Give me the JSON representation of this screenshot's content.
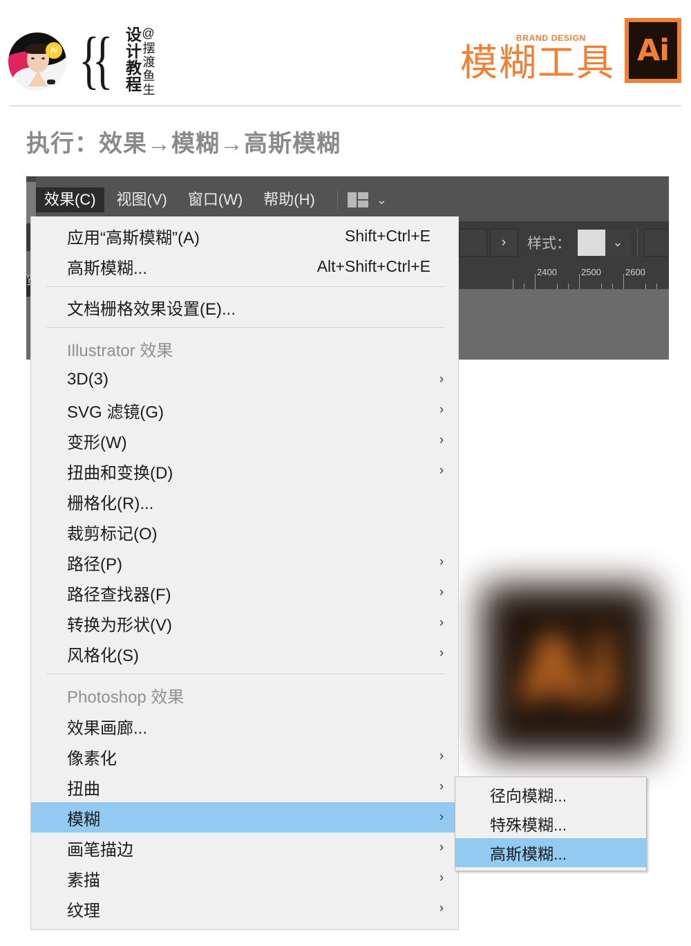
{
  "header": {
    "avatar_badge": "hi",
    "braces": "{{",
    "vertical_main": "设计教程",
    "vertical_sub": "@摆渡鱼生",
    "brand_sub": "BRAND DESIGN",
    "brand_title": "模糊工具",
    "ai_badge": "Ai"
  },
  "subtitle": "执行：效果→模糊→高斯模糊",
  "app": {
    "menubar": [
      {
        "label": "效果(C)",
        "active": true
      },
      {
        "label": "视图(V)",
        "active": false
      },
      {
        "label": "窗口(W)",
        "active": false
      },
      {
        "label": "帮助(H)",
        "active": false
      }
    ],
    "workspace_icon": "layout-grid-icon",
    "workspace_chevron": "⌄",
    "control_bar": {
      "arrow_button": "›",
      "style_label": "样式：",
      "style_chevron": "⌄"
    },
    "ruler_labels": [
      "2400",
      "2500",
      "2600"
    ],
    "left_panel_tab": "览"
  },
  "menu": {
    "items": [
      {
        "label": "应用“高斯模糊”(A)",
        "accel": "Shift+Ctrl+E",
        "arrow": "",
        "kind": "item",
        "selected": false
      },
      {
        "label": "高斯模糊...",
        "accel": "Alt+Shift+Ctrl+E",
        "arrow": "",
        "kind": "item",
        "selected": false
      },
      {
        "kind": "divider"
      },
      {
        "label": "文档栅格效果设置(E)...",
        "accel": "",
        "arrow": "",
        "kind": "item",
        "selected": false
      },
      {
        "kind": "divider"
      },
      {
        "label": "Illustrator 效果",
        "accel": "",
        "arrow": "",
        "kind": "header",
        "selected": false
      },
      {
        "label": "3D(3)",
        "accel": "",
        "arrow": "›",
        "kind": "item",
        "selected": false
      },
      {
        "label": "SVG 滤镜(G)",
        "accel": "",
        "arrow": "›",
        "kind": "item",
        "selected": false
      },
      {
        "label": "变形(W)",
        "accel": "",
        "arrow": "›",
        "kind": "item",
        "selected": false
      },
      {
        "label": "扭曲和变换(D)",
        "accel": "",
        "arrow": "›",
        "kind": "item",
        "selected": false
      },
      {
        "label": "栅格化(R)...",
        "accel": "",
        "arrow": "",
        "kind": "item",
        "selected": false
      },
      {
        "label": "裁剪标记(O)",
        "accel": "",
        "arrow": "",
        "kind": "item",
        "selected": false
      },
      {
        "label": "路径(P)",
        "accel": "",
        "arrow": "›",
        "kind": "item",
        "selected": false
      },
      {
        "label": "路径查找器(F)",
        "accel": "",
        "arrow": "›",
        "kind": "item",
        "selected": false
      },
      {
        "label": "转换为形状(V)",
        "accel": "",
        "arrow": "›",
        "kind": "item",
        "selected": false
      },
      {
        "label": "风格化(S)",
        "accel": "",
        "arrow": "›",
        "kind": "item",
        "selected": false
      },
      {
        "kind": "divider"
      },
      {
        "label": "Photoshop 效果",
        "accel": "",
        "arrow": "",
        "kind": "header",
        "selected": false
      },
      {
        "label": "效果画廊...",
        "accel": "",
        "arrow": "",
        "kind": "item",
        "selected": false
      },
      {
        "label": "像素化",
        "accel": "",
        "arrow": "›",
        "kind": "item",
        "selected": false
      },
      {
        "label": "扭曲",
        "accel": "",
        "arrow": "›",
        "kind": "item",
        "selected": false
      },
      {
        "label": "模糊",
        "accel": "",
        "arrow": "›",
        "kind": "item",
        "selected": true
      },
      {
        "label": "画笔描边",
        "accel": "",
        "arrow": "›",
        "kind": "item",
        "selected": false
      },
      {
        "label": "素描",
        "accel": "",
        "arrow": "›",
        "kind": "item",
        "selected": false
      },
      {
        "label": "纹理",
        "accel": "",
        "arrow": "›",
        "kind": "item",
        "selected": false
      }
    ]
  },
  "submenu": {
    "items": [
      {
        "label": "径向模糊...",
        "selected": false
      },
      {
        "label": "特殊模糊...",
        "selected": false
      },
      {
        "label": "高斯模糊...",
        "selected": true
      }
    ]
  },
  "colors": {
    "brand_orange": "#ef8036",
    "selection_blue": "#92caf2",
    "subtitle_gray": "#8a8a8a",
    "menu_bg": "#f0f0f0",
    "app_chrome": "#535353"
  }
}
